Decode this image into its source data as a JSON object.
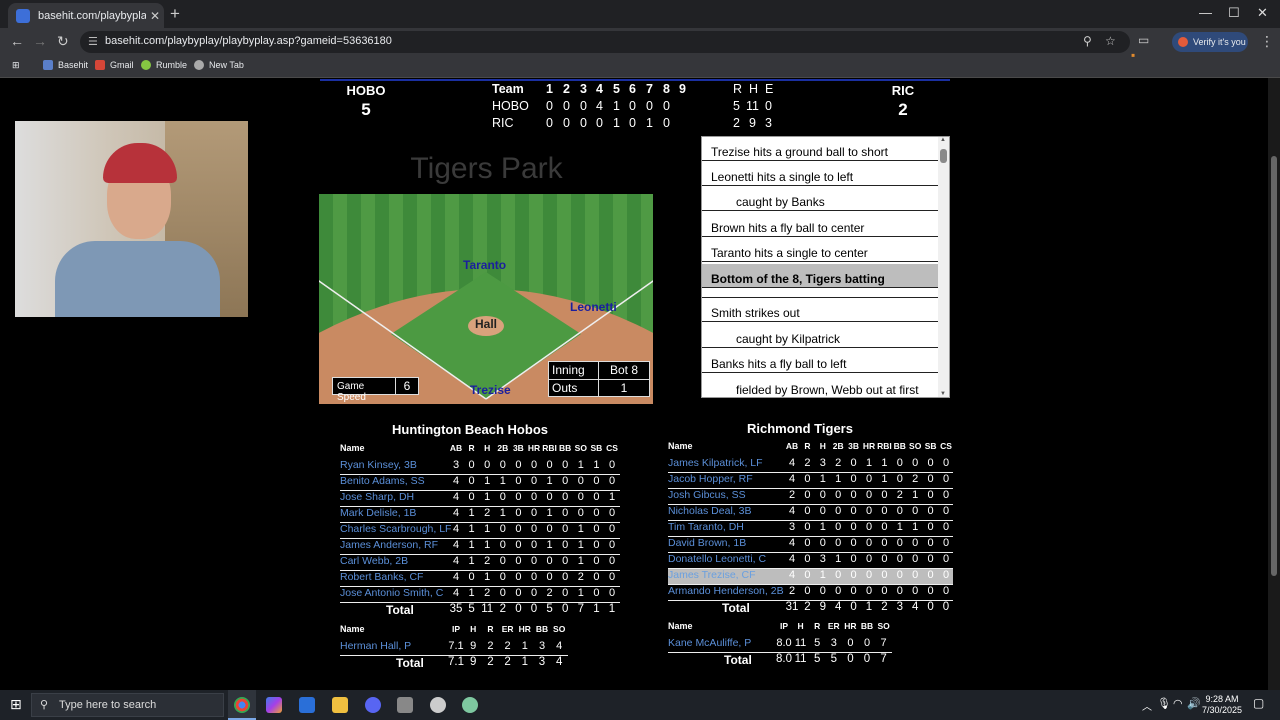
{
  "browser": {
    "tab_title": "basehit.com/playbyplay/playby",
    "url": "basehit.com/playbyplay/playbyplay.asp?gameid=53636180",
    "verify_label": "Verify it's you",
    "bookmarks": [
      "Basehit",
      "Gmail",
      "Rumble",
      "New Tab"
    ]
  },
  "scoreboard": {
    "away_abbr": "HOBO",
    "away_runs": "5",
    "home_abbr": "RIC",
    "home_runs": "2",
    "header": {
      "team": "Team",
      "innings": [
        "1",
        "2",
        "3",
        "4",
        "5",
        "6",
        "7",
        "8",
        "9"
      ],
      "r": "R",
      "h": "H",
      "e": "E"
    },
    "rows": [
      {
        "team": "HOBO",
        "innings": [
          "0",
          "0",
          "0",
          "4",
          "1",
          "0",
          "0",
          "0",
          ""
        ],
        "r": "5",
        "h": "11",
        "e": "0"
      },
      {
        "team": "RIC",
        "innings": [
          "0",
          "0",
          "0",
          "0",
          "1",
          "0",
          "1",
          "0",
          ""
        ],
        "r": "2",
        "h": "9",
        "e": "3"
      }
    ]
  },
  "park": {
    "name": "Tigers Park",
    "fielders": {
      "cf": "Taranto",
      "rf": "Leonetti",
      "p": "Hall",
      "bat": "Trezise"
    },
    "speed_label": "Game Speed",
    "speed_value": "6",
    "inning_label": "Inning",
    "inning_value": "Bot 8",
    "outs_label": "Outs",
    "outs_value": "1"
  },
  "pbp": [
    {
      "text": "Trezise hits a ground ball to short",
      "type": "normal"
    },
    {
      "text": "Leonetti hits a single to left",
      "type": "normal"
    },
    {
      "text": "caught by Banks",
      "type": "indent"
    },
    {
      "text": "Brown hits a fly ball to center",
      "type": "normal"
    },
    {
      "text": "Taranto hits a single to center",
      "type": "normal"
    },
    {
      "text": "Bottom of the 8, Tigers batting",
      "type": "header"
    },
    {
      "text": "",
      "type": "normal"
    },
    {
      "text": "Smith strikes out",
      "type": "normal"
    },
    {
      "text": "caught by Kilpatrick",
      "type": "indent"
    },
    {
      "text": "Banks hits a fly ball to left",
      "type": "normal"
    },
    {
      "text": "fielded by Brown, Webb out at first",
      "type": "indent"
    }
  ],
  "away_box": {
    "title": "Huntington Beach Hobos",
    "name_header": "Name",
    "cols": [
      "AB",
      "R",
      "H",
      "2B",
      "3B",
      "HR",
      "RBI",
      "BB",
      "SO",
      "SB",
      "CS"
    ],
    "rows": [
      {
        "name": "Ryan Kinsey, 3B",
        "stats": [
          "3",
          "0",
          "0",
          "0",
          "0",
          "0",
          "0",
          "0",
          "1",
          "1",
          "0"
        ]
      },
      {
        "name": "Benito Adams, SS",
        "stats": [
          "4",
          "0",
          "1",
          "1",
          "0",
          "0",
          "1",
          "0",
          "0",
          "0",
          "0"
        ]
      },
      {
        "name": "Jose Sharp, DH",
        "stats": [
          "4",
          "0",
          "1",
          "0",
          "0",
          "0",
          "0",
          "0",
          "0",
          "0",
          "1"
        ]
      },
      {
        "name": "Mark Delisle, 1B",
        "stats": [
          "4",
          "1",
          "2",
          "1",
          "0",
          "0",
          "1",
          "0",
          "0",
          "0",
          "0"
        ]
      },
      {
        "name": "Charles Scarbrough, LF",
        "stats": [
          "4",
          "1",
          "1",
          "0",
          "0",
          "0",
          "0",
          "0",
          "1",
          "0",
          "0"
        ]
      },
      {
        "name": "James Anderson, RF",
        "stats": [
          "4",
          "1",
          "1",
          "0",
          "0",
          "0",
          "1",
          "0",
          "1",
          "0",
          "0"
        ]
      },
      {
        "name": "Carl Webb, 2B",
        "stats": [
          "4",
          "1",
          "2",
          "0",
          "0",
          "0",
          "0",
          "0",
          "1",
          "0",
          "0"
        ]
      },
      {
        "name": "Robert Banks, CF",
        "stats": [
          "4",
          "0",
          "1",
          "0",
          "0",
          "0",
          "0",
          "0",
          "2",
          "0",
          "0"
        ]
      },
      {
        "name": "Jose Antonio Smith, C",
        "stats": [
          "4",
          "1",
          "2",
          "0",
          "0",
          "0",
          "2",
          "0",
          "1",
          "0",
          "0"
        ]
      }
    ],
    "total": {
      "label": "Total",
      "stats": [
        "35",
        "5",
        "11",
        "2",
        "0",
        "0",
        "5",
        "0",
        "7",
        "1",
        "1"
      ]
    },
    "pitch_cols": [
      "IP",
      "H",
      "R",
      "ER",
      "HR",
      "BB",
      "SO"
    ],
    "pitchers": [
      {
        "name": "Herman Hall, P",
        "stats": [
          "7.1",
          "9",
          "2",
          "2",
          "1",
          "3",
          "4"
        ]
      }
    ],
    "pitch_total": {
      "label": "Total",
      "stats": [
        "7.1",
        "9",
        "2",
        "2",
        "1",
        "3",
        "4"
      ]
    }
  },
  "home_box": {
    "title": "Richmond Tigers",
    "name_header": "Name",
    "cols": [
      "AB",
      "R",
      "H",
      "2B",
      "3B",
      "HR",
      "RBI",
      "BB",
      "SO",
      "SB",
      "CS"
    ],
    "rows": [
      {
        "name": "James Kilpatrick, LF",
        "stats": [
          "4",
          "2",
          "3",
          "2",
          "0",
          "1",
          "1",
          "0",
          "0",
          "0",
          "0"
        ]
      },
      {
        "name": "Jacob Hopper, RF",
        "stats": [
          "4",
          "0",
          "1",
          "1",
          "0",
          "0",
          "1",
          "0",
          "2",
          "0",
          "0"
        ]
      },
      {
        "name": "Josh Gibcus, SS",
        "stats": [
          "2",
          "0",
          "0",
          "0",
          "0",
          "0",
          "0",
          "2",
          "1",
          "0",
          "0"
        ]
      },
      {
        "name": "Nicholas Deal, 3B",
        "stats": [
          "4",
          "0",
          "0",
          "0",
          "0",
          "0",
          "0",
          "0",
          "0",
          "0",
          "0"
        ]
      },
      {
        "name": "Tim Taranto, DH",
        "stats": [
          "3",
          "0",
          "1",
          "0",
          "0",
          "0",
          "0",
          "1",
          "1",
          "0",
          "0"
        ]
      },
      {
        "name": "David Brown, 1B",
        "stats": [
          "4",
          "0",
          "0",
          "0",
          "0",
          "0",
          "0",
          "0",
          "0",
          "0",
          "0"
        ]
      },
      {
        "name": "Donatello Leonetti, C",
        "stats": [
          "4",
          "0",
          "3",
          "1",
          "0",
          "0",
          "0",
          "0",
          "0",
          "0",
          "0"
        ]
      },
      {
        "name": "James Trezise, CF",
        "stats": [
          "4",
          "0",
          "1",
          "0",
          "0",
          "0",
          "0",
          "0",
          "0",
          "0",
          "0"
        ]
      },
      {
        "name": "Armando Henderson, 2B",
        "stats": [
          "2",
          "0",
          "0",
          "0",
          "0",
          "0",
          "0",
          "0",
          "0",
          "0",
          "0"
        ]
      }
    ],
    "total": {
      "label": "Total",
      "stats": [
        "31",
        "2",
        "9",
        "4",
        "0",
        "1",
        "2",
        "3",
        "4",
        "0",
        "0"
      ]
    },
    "pitch_cols": [
      "IP",
      "H",
      "R",
      "ER",
      "HR",
      "BB",
      "SO"
    ],
    "pitchers": [
      {
        "name": "Kane McAuliffe, P",
        "stats": [
          "8.0",
          "11",
          "5",
          "3",
          "0",
          "0",
          "7"
        ]
      }
    ],
    "pitch_total": {
      "label": "Total",
      "stats": [
        "8.0",
        "11",
        "5",
        "5",
        "0",
        "0",
        "7"
      ]
    }
  },
  "taskbar": {
    "search_placeholder": "Type here to search",
    "time": "9:28 AM",
    "date": "7/30/2025"
  }
}
